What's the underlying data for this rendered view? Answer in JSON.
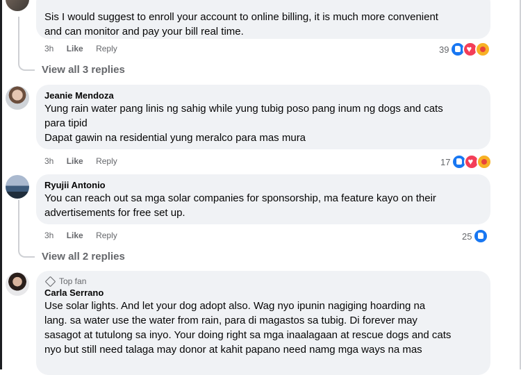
{
  "comments": [
    {
      "author": "",
      "text": "Sis I would suggest to enroll your account to online billing, it is much more convenient\nand can monitor and pay your bill real time.",
      "time": "3h",
      "like": "Like",
      "reply": "Reply",
      "reaction_count": "39",
      "reactions": [
        "like-icon",
        "love-icon",
        "care-icon"
      ],
      "view_replies": "View all 3 replies"
    },
    {
      "author": "Jeanie Mendoza",
      "text": "Yung rain water pang linis ng sahig while yung tubig poso pang inum ng dogs and cats\npara tipid\nDapat gawin na residential yung meralco para mas mura",
      "time": "3h",
      "like": "Like",
      "reply": "Reply",
      "reaction_count": "17",
      "reactions": [
        "like-icon",
        "love-icon",
        "care-icon"
      ]
    },
    {
      "author": "Ryujii Antonio",
      "text": "You can reach out sa mga solar companies for sponsorship, ma feature kayo on their\nadvertisements for free set up.",
      "time": "3h",
      "like": "Like",
      "reply": "Reply",
      "reaction_count": "25",
      "reactions": [
        "like-icon"
      ],
      "view_replies": "View all 2 replies"
    },
    {
      "badge": "Top fan",
      "author": "Carla Serrano",
      "text": "Use solar lights. And let your dog adopt also. Wag nyo ipunin nagiging hoarding na\nlang. sa water use the water from rain, para di magastos sa tubig. Di forever may\nsasagot at tutulong sa inyo. Your doing right sa mga inaalagaan at rescue dogs and cats\nnyo but still need talaga may donor at kahit papano need namg mga ways na mas"
    }
  ],
  "colors": {
    "bubble": "#f0f2f5",
    "muted": "#65676b",
    "like": "#1877f2",
    "love": "#f33e58",
    "care": "#f7b125"
  }
}
